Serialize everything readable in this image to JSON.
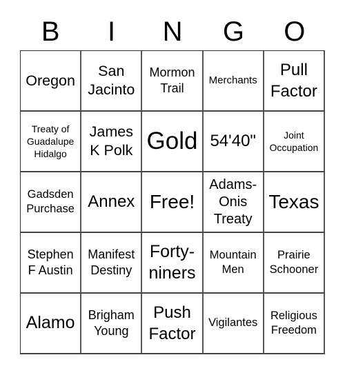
{
  "header": [
    "B",
    "I",
    "N",
    "G",
    "O"
  ],
  "cells": [
    "Oregon",
    "San Jacinto",
    "Mormon Trail",
    "Merchants",
    "Pull Factor",
    "Treaty of Guadalupe Hidalgo",
    "James K Polk",
    "Gold",
    "54'40\"",
    "Joint Occupation",
    "Gadsden Purchase",
    "Annex",
    "Free!",
    "Adams-Onis Treaty",
    "Texas",
    "Stephen F Austin",
    "Manifest Destiny",
    "Forty-niners",
    "Mountain Men",
    "Prairie Schooner",
    "Alamo",
    "Brigham Young",
    "Push Factor",
    "Vigilantes",
    "Religious Freedom"
  ],
  "free_space": "Free!"
}
